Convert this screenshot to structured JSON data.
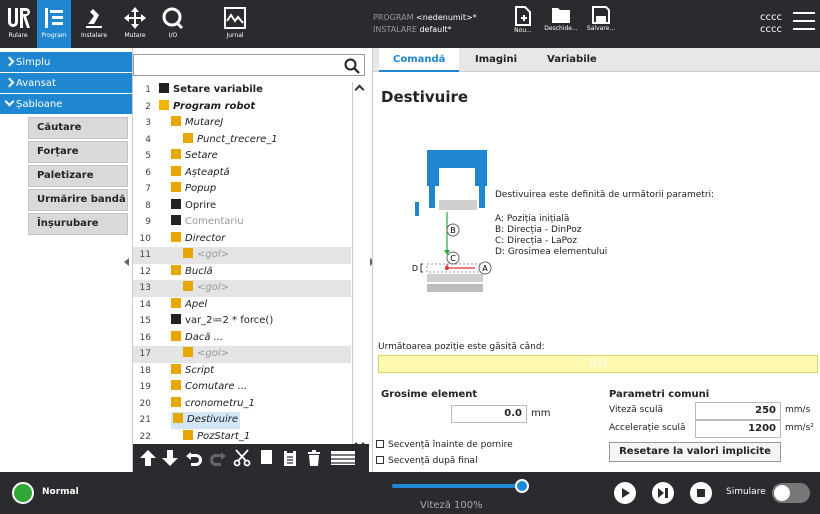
{
  "header": {
    "nav": [
      {
        "label": "Rulare",
        "icon": "ur-logo-icon"
      },
      {
        "label": "Program",
        "icon": "program-icon"
      },
      {
        "label": "Instalare",
        "icon": "installation-icon"
      },
      {
        "label": "Mutare",
        "icon": "move-icon"
      },
      {
        "label": "I/O",
        "icon": "io-icon"
      },
      {
        "label": "Jurnal",
        "icon": "log-icon"
      }
    ],
    "program_label": "PROGRAM",
    "program_value": "<nedenumit>*",
    "install_label": "INSTALARE",
    "install_value": "default*",
    "file_buttons": [
      {
        "label": "Nou...",
        "icon": "new-file-icon"
      },
      {
        "label": "Deschide...",
        "icon": "folder-icon"
      },
      {
        "label": "Salvare...",
        "icon": "save-icon"
      }
    ],
    "user1": "cccc",
    "user2": "cccc"
  },
  "sidebar": {
    "sections": [
      {
        "label": "Simplu"
      },
      {
        "label": "Avansat"
      },
      {
        "label": "Șabloane"
      }
    ],
    "templates": [
      "Căutare",
      "Forțare",
      "Paletizare",
      "Urmărire bandă",
      "Înșurubare"
    ]
  },
  "tree": {
    "rows": [
      {
        "n": "1",
        "text": "Setare variabile",
        "style": "bold",
        "icon": "x-icon",
        "indent": 0
      },
      {
        "n": "2",
        "text": "Program robot",
        "style": "bolditalic",
        "icon": "triangle-down-icon",
        "indent": 0
      },
      {
        "n": "3",
        "text": "MutareJ",
        "style": "italic",
        "icon": "move-icon",
        "indent": 1
      },
      {
        "n": "4",
        "text": "Punct_trecere_1",
        "style": "italic",
        "icon": "waypoint-icon",
        "indent": 2
      },
      {
        "n": "5",
        "text": "Setare",
        "style": "italic",
        "icon": "set-icon",
        "indent": 1
      },
      {
        "n": "6",
        "text": "Așteaptă",
        "style": "italic",
        "icon": "hourglass-icon",
        "indent": 1
      },
      {
        "n": "7",
        "text": "Popup",
        "style": "italic",
        "icon": "popup-icon",
        "indent": 1
      },
      {
        "n": "8",
        "text": "Oprire",
        "style": "normal",
        "icon": "halt-icon",
        "indent": 1
      },
      {
        "n": "9",
        "text": "Comentariu",
        "style": "gray",
        "icon": "comment-icon",
        "indent": 1
      },
      {
        "n": "10",
        "text": "Director",
        "style": "italic",
        "icon": "folder-icon",
        "indent": 1
      },
      {
        "n": "11",
        "text": "<gol>",
        "style": "grayitalic",
        "icon": "empty-icon",
        "indent": 2,
        "hl": true
      },
      {
        "n": "12",
        "text": "Buclă",
        "style": "italic",
        "icon": "loop-icon",
        "indent": 1
      },
      {
        "n": "13",
        "text": "<gol>",
        "style": "grayitalic",
        "icon": "empty-icon",
        "indent": 2,
        "hl": true
      },
      {
        "n": "14",
        "text": "Apel",
        "style": "italic",
        "icon": "call-icon",
        "indent": 1
      },
      {
        "n": "15",
        "text": "var_2≔2 * force()",
        "style": "normal",
        "icon": "assign-icon",
        "indent": 1
      },
      {
        "n": "16",
        "text": "Dacă ...",
        "style": "italic",
        "icon": "if-icon",
        "indent": 1
      },
      {
        "n": "17",
        "text": "<gol>",
        "style": "grayitalic",
        "icon": "empty-icon",
        "indent": 2,
        "hl": true
      },
      {
        "n": "18",
        "text": "Script",
        "style": "italic",
        "icon": "script-icon",
        "indent": 1
      },
      {
        "n": "19",
        "text": "Comutare ...",
        "style": "italic",
        "icon": "switch-icon",
        "indent": 1
      },
      {
        "n": "20",
        "text": "cronometru_1",
        "style": "italic",
        "icon": "timer-icon",
        "indent": 1
      },
      {
        "n": "21",
        "text": "Destivuire",
        "style": "italic",
        "icon": "destack-icon",
        "indent": 1,
        "selected": true
      },
      {
        "n": "22",
        "text": "PozStart_1",
        "style": "italic",
        "icon": "waypoint-icon",
        "indent": 2
      }
    ]
  },
  "main": {
    "tabs": [
      "Comandă",
      "Imagini",
      "Variabile"
    ],
    "title": "Destivuire",
    "desc": "Destivuirea este definită de următorii parametri:",
    "params": [
      "A: Poziția inițială",
      "B: Direcția - DinPoz",
      "C: Direcția - LaPoz",
      "D: Grosimea elementului"
    ],
    "diagram_labels": {
      "a": "A",
      "b": "B",
      "c": "C",
      "d": "D"
    },
    "next_condition_label": "Următoarea poziție este găsită când:",
    "expression": "f(x)",
    "thickness_title": "Grosime element",
    "thickness_value": "0.0",
    "thickness_unit": "mm",
    "common_title": "Parametri comuni",
    "tool_speed_label": "Viteză sculă",
    "tool_speed_value": "250",
    "tool_speed_unit": "mm/s",
    "tool_acc_label": "Accelerație sculă",
    "tool_acc_value": "1200",
    "tool_acc_unit": "mm/s²",
    "check1": "Secvență înainte de pornire",
    "check2": "Secvență după final",
    "reset": "Resetare la valori implicite"
  },
  "footer": {
    "status": "Normal",
    "speed_label": "Viteză 100%",
    "speed_fraction": 1.0,
    "simulation": "Simulare"
  },
  "colors": {
    "accent": "#1f86d1",
    "dark": "#2a2b2e",
    "status_green": "#2fa836"
  }
}
